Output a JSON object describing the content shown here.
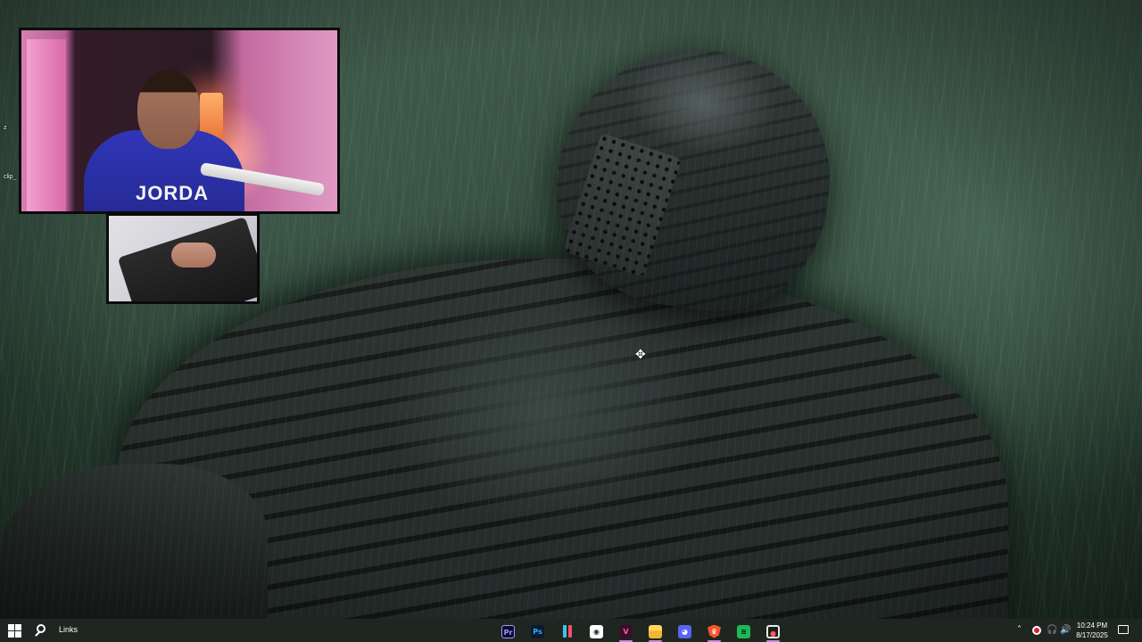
{
  "desktop": {
    "wallpaper_subject": "",
    "edge_labels": [
      "z",
      "clip_"
    ]
  },
  "webcam": {
    "shirt_text": "JORDA"
  },
  "taskbar": {
    "search_label": "Links",
    "start_icon": "windows-logo-icon",
    "search_icon": "search-icon",
    "apps": [
      {
        "name": "Adobe Premiere Pro",
        "icon": "premiere-icon",
        "glyph": "Pr",
        "running": false
      },
      {
        "name": "Adobe Photoshop",
        "icon": "photoshop-icon",
        "glyph": "Ps",
        "running": false
      },
      {
        "name": "CapCut",
        "icon": "capcut-icon",
        "glyph": "",
        "running": false
      },
      {
        "name": "OBS Studio",
        "icon": "obs-icon",
        "glyph": "◉",
        "running": false
      },
      {
        "name": "Vegas",
        "icon": "vegas-icon",
        "glyph": "V",
        "running": true
      },
      {
        "name": "File Explorer",
        "icon": "folder-icon",
        "glyph": "",
        "running": true
      },
      {
        "name": "Discord",
        "icon": "discord-icon",
        "glyph": "◕",
        "running": false
      },
      {
        "name": "Brave",
        "icon": "brave-icon",
        "glyph": "♛",
        "running": true
      },
      {
        "name": "Spotify",
        "icon": "spotify-icon",
        "glyph": "≋",
        "running": false
      },
      {
        "name": "Recorder",
        "icon": "recorder-icon",
        "glyph": "●",
        "running": true
      }
    ],
    "tray": {
      "chevron_icon": "chevron-up-icon",
      "time": "10:24 PM",
      "date": "8/17/2025"
    }
  }
}
